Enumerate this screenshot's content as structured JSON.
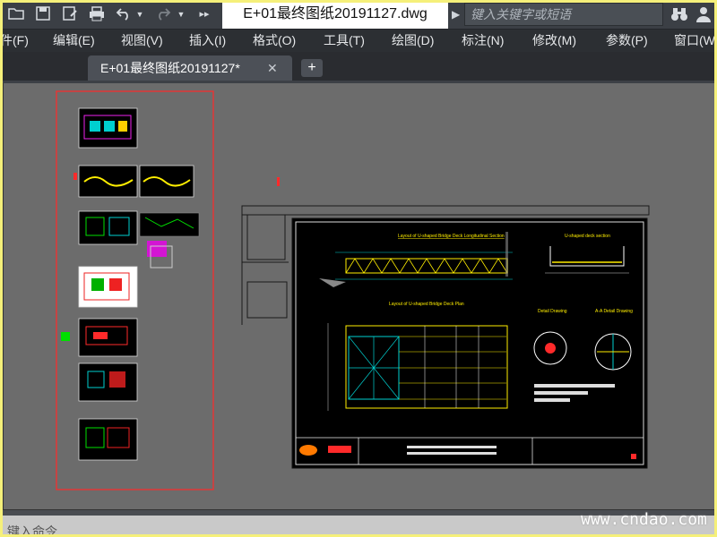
{
  "titlebar": {
    "document_title": "E+01最终图纸20191127.dwg",
    "search_placeholder": "键入关键字或短语",
    "arrow_glyph": "▶"
  },
  "menubar": {
    "items": [
      "件(F)",
      "编辑(E)",
      "视图(V)",
      "插入(I)",
      "格式(O)",
      "工具(T)",
      "绘图(D)",
      "标注(N)",
      "修改(M)",
      "参数(P)",
      "窗口(W"
    ]
  },
  "tabs": {
    "active_label": "E+01最终图纸20191127*",
    "close_glyph": "✕",
    "new_tab_glyph": "+"
  },
  "drawing": {
    "sheet_titles": {
      "elevation": "Layout of U-shaped Bridge Deck Longitudinal Section",
      "cross_section": "U-shaped deck section",
      "plan": "Layout of U-shaped Bridge Deck Plan",
      "detail_left": "Detail Drawing",
      "detail_right": "A-A Detail Drawing"
    }
  },
  "command": {
    "prompt": "键入命令"
  },
  "watermark": "www.cndao.com",
  "colors": {
    "canvas": "#6c6c6c",
    "selection": "#ff2a2a",
    "sheet_bg": "#000000",
    "titlebar": "#3b3f45"
  }
}
